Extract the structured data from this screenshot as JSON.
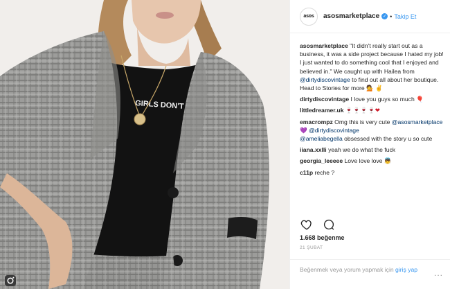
{
  "post": {
    "username": "asosmarketplace",
    "avatar_text": "asos",
    "verified_icon": "verified-badge-icon",
    "follow_separator": "•",
    "follow_label": "Takip Et",
    "likes": "1.668 beğenme",
    "time": "21 şubat"
  },
  "photo": {
    "shirt_text": "GIRLS DON'T CRY."
  },
  "caption": {
    "author": "asosmarketplace",
    "text_before": " \"It didn't really start out as a business, it was a side project because I hated my job! I just wanted to do something cool that I enjoyed and believed in.\" We caught up with Hailea from ",
    "mention": "@dirtydiscovintage",
    "text_after": " to find out all about her boutique. Head to Stories for more 💁 ✌"
  },
  "comments": [
    {
      "author": "dirtydiscovintage",
      "text": " I love you guys so much 🎈"
    },
    {
      "author": "littledreamer.uk",
      "text": " 🍷🍷🍷🍷❤"
    },
    {
      "author": "emacrompz",
      "text": " Omg this is very cute ",
      "mention1": "@asosmarketplace",
      "emoji": " 💜 ",
      "mention2": "@dirtydiscovintage"
    },
    {
      "author": "",
      "mention": "@ameliabegella",
      "text": " obsessed with the story u so cute"
    },
    {
      "author": "iiana.xxlli",
      "text": " yeah we do what the fuck"
    },
    {
      "author": "georgia_leeeee",
      "text": " Love love love 👼"
    },
    {
      "author": "c11p",
      "text": " reche ?"
    }
  ],
  "add_comment": {
    "placeholder": "Beğenmek veya yorum yapmak için ",
    "login": "giriş yap",
    "more": "..."
  },
  "colors": {
    "accent": "#3897f0",
    "text": "#262626",
    "muted": "#999999",
    "mention": "#003569"
  },
  "icons": [
    "heart-icon",
    "comment-icon",
    "more-options-icon",
    "instagram-icon"
  ]
}
